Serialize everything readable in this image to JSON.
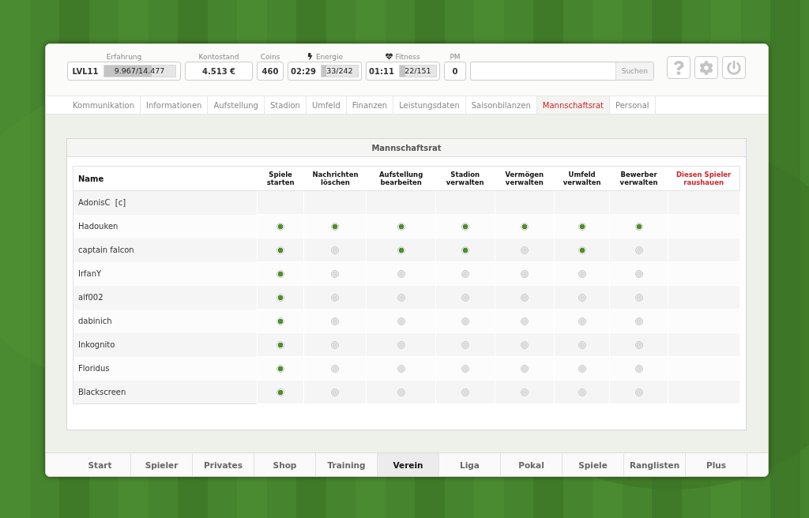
{
  "stats": {
    "experience": {
      "label": "Erfahrung",
      "level_text": "LVL11",
      "progress": "9.967/14.477",
      "level": 0.67
    },
    "balance": {
      "label": "Kontostand",
      "value": "4.513 €"
    },
    "coins": {
      "label": "Coins",
      "value": "460"
    },
    "energy": {
      "label": "Energie",
      "time": "02:29",
      "progress": "33/242",
      "level": 0.14
    },
    "fitness": {
      "label": "Fitness",
      "time": "01:11",
      "progress": "22/151",
      "level": 0.15
    },
    "pm": {
      "label": "PM",
      "value": "0"
    }
  },
  "search": {
    "button": "Suchen"
  },
  "sub_tabs": [
    {
      "label": "Kommunikation",
      "selected": false
    },
    {
      "label": "Informationen",
      "selected": false
    },
    {
      "label": "Aufstellung",
      "selected": false
    },
    {
      "label": "Stadion",
      "selected": false
    },
    {
      "label": "Umfeld",
      "selected": false
    },
    {
      "label": "Finanzen",
      "selected": false
    },
    {
      "label": "Leistungsdaten",
      "selected": false
    },
    {
      "label": "Saisonbilanzen",
      "selected": false
    },
    {
      "label": "Mannschaftsrat",
      "selected": true
    },
    {
      "label": "Personal",
      "selected": false
    }
  ],
  "panel": {
    "title": "Mannschaftsrat",
    "columns": [
      {
        "label": "Name",
        "kind": "name"
      },
      {
        "label": "Spiele starten",
        "kind": "right"
      },
      {
        "label": "Nachrichten löschen",
        "kind": "right"
      },
      {
        "label": "Aufstellung bearbeiten",
        "kind": "right"
      },
      {
        "label": "Stadion verwalten",
        "kind": "right"
      },
      {
        "label": "Vermögen verwalten",
        "kind": "right"
      },
      {
        "label": "Umfeld verwalten",
        "kind": "right"
      },
      {
        "label": "Bewerber verwalten",
        "kind": "right"
      },
      {
        "label": "Diesen Spieler raushauen",
        "kind": "danger"
      }
    ],
    "rows": [
      {
        "name": "AdonisC  [c]"
      },
      {
        "name": "Hadouken",
        "rights": [
          true,
          true,
          true,
          true,
          true,
          true,
          true
        ]
      },
      {
        "name": "captain falcon",
        "rights": [
          true,
          false,
          true,
          true,
          false,
          true,
          false
        ]
      },
      {
        "name": "IrfanY",
        "rights": [
          true,
          false,
          false,
          false,
          false,
          false,
          false
        ]
      },
      {
        "name": "alf002",
        "rights": [
          true,
          false,
          false,
          false,
          false,
          false,
          false
        ]
      },
      {
        "name": "dabinich",
        "rights": [
          true,
          false,
          false,
          false,
          false,
          false,
          false
        ]
      },
      {
        "name": "Inkognito",
        "rights": [
          true,
          false,
          false,
          false,
          false,
          false,
          false
        ]
      },
      {
        "name": "Floridus",
        "rights": [
          true,
          false,
          false,
          false,
          false,
          false,
          false
        ]
      },
      {
        "name": "Blackscreen",
        "rights": [
          true,
          false,
          false,
          false,
          false,
          false,
          false
        ]
      }
    ]
  },
  "nav": [
    {
      "label": "Start",
      "selected": false
    },
    {
      "label": "Spieler",
      "selected": false
    },
    {
      "label": "Privates",
      "selected": false
    },
    {
      "label": "Shop",
      "selected": false
    },
    {
      "label": "Training",
      "selected": false
    },
    {
      "label": "Verein",
      "selected": true
    },
    {
      "label": "Liga",
      "selected": false
    },
    {
      "label": "Pokal",
      "selected": false
    },
    {
      "label": "Spiele",
      "selected": false
    },
    {
      "label": "Ranglisten",
      "selected": false
    },
    {
      "label": "Plus",
      "selected": false
    }
  ]
}
